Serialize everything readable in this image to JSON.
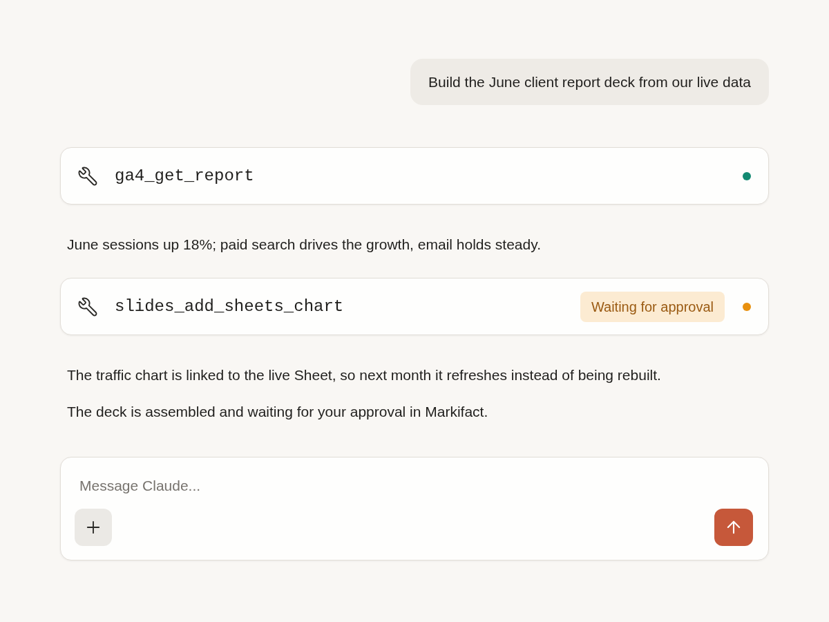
{
  "conversation": [
    {
      "kind": "user",
      "text": "Build the June client report deck from our live data"
    },
    {
      "kind": "tool",
      "name": "ga4_get_report",
      "color": "#138a72"
    },
    {
      "kind": "text",
      "text": "June sessions up 18%; paid search drives the growth, email holds steady."
    },
    {
      "kind": "tool",
      "name": "slides_add_sheets_chart",
      "badge": "Waiting for approval",
      "color": "#e8900f"
    },
    {
      "kind": "text",
      "text": "The traffic chart is linked to the live Sheet, so next month it refreshes instead of being rebuilt."
    },
    {
      "kind": "text",
      "text": "The deck is assembled and waiting for your approval in Markifact."
    }
  ],
  "composer": {
    "placeholder": "Message Claude..."
  }
}
